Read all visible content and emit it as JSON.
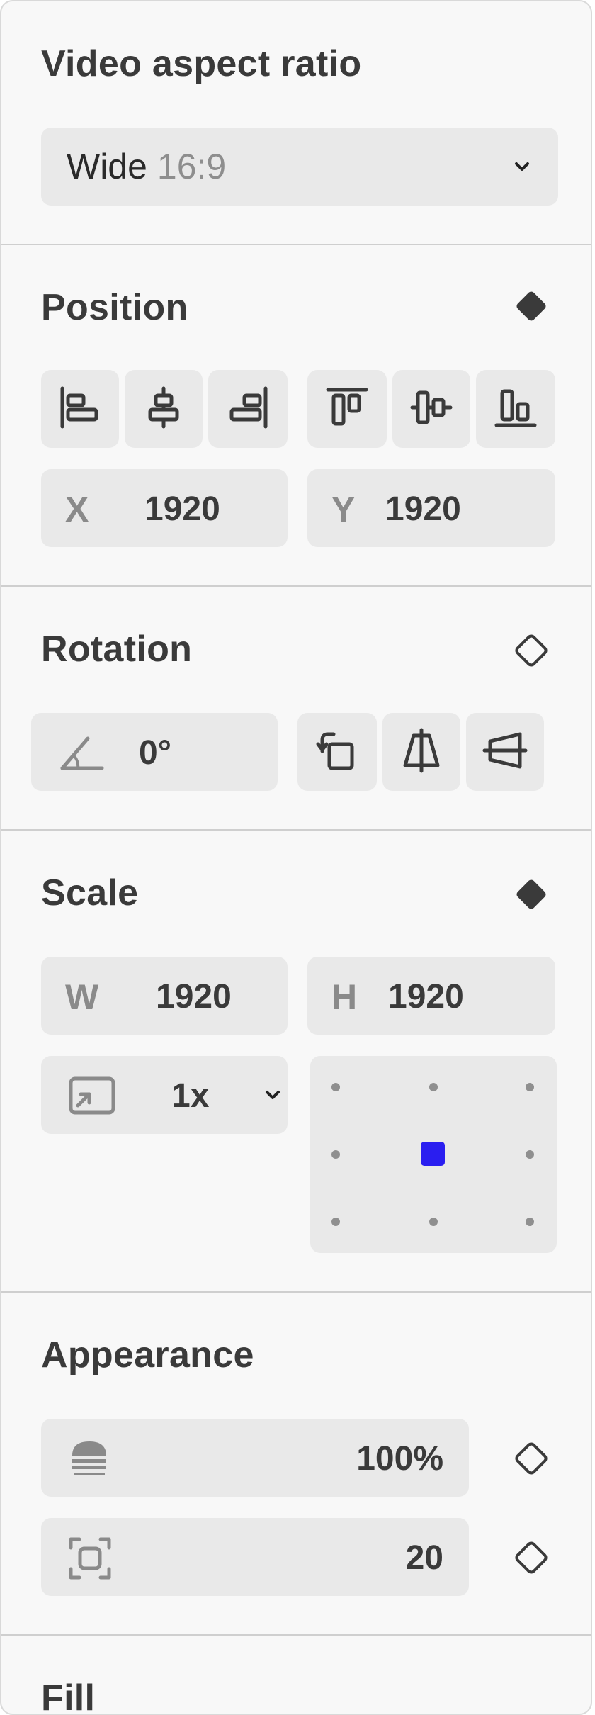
{
  "aspect": {
    "title": "Video aspect ratio",
    "value_name": "Wide",
    "value_ratio": "16:9"
  },
  "position": {
    "title": "Position",
    "x_label": "X",
    "x_value": "1920",
    "y_label": "Y",
    "y_value": "1920"
  },
  "rotation": {
    "title": "Rotation",
    "angle_value": "0°"
  },
  "scale": {
    "title": "Scale",
    "w_label": "W",
    "w_value": "1920",
    "h_label": "H",
    "h_value": "1920",
    "factor_value": "1x",
    "anchor_selected": "center"
  },
  "appearance": {
    "title": "Appearance",
    "opacity_value": "100%",
    "corner_value": "20"
  },
  "fill": {
    "title": "Fill"
  },
  "colors": {
    "anchor_accent": "#2a1ef0",
    "keyframe_filled": "#3a3a3a"
  }
}
